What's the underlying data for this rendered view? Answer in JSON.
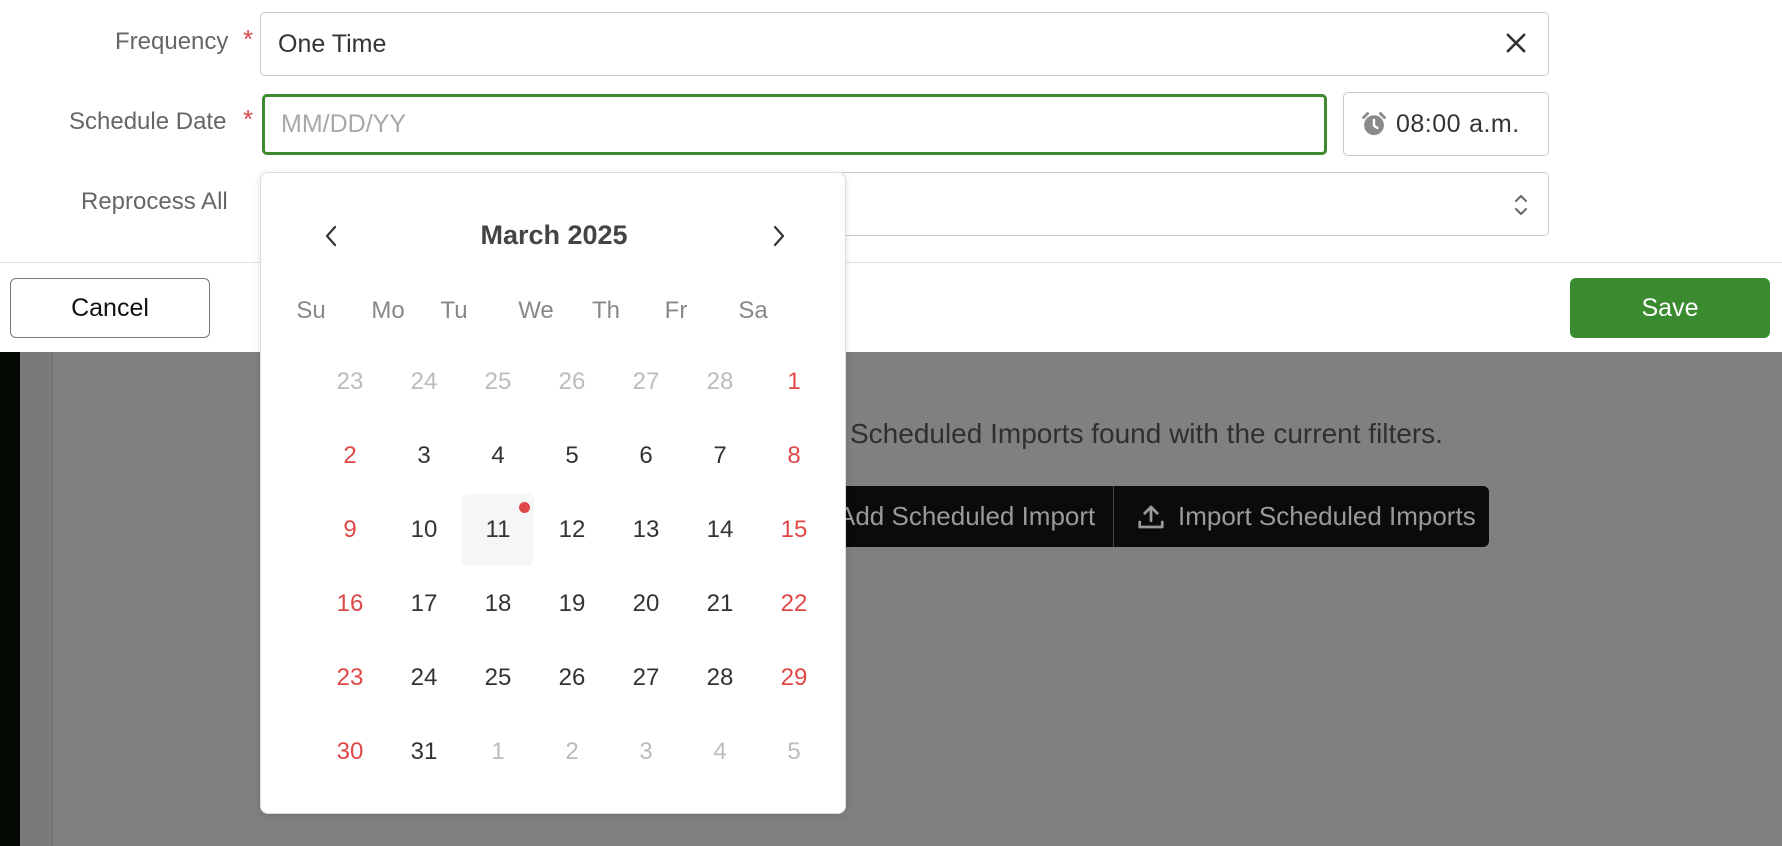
{
  "form": {
    "frequency_label": "Frequency",
    "frequency_value": "One Time",
    "schedule_date_label": "Schedule Date",
    "schedule_date_placeholder": "MM/DD/YY",
    "time_value": "08:00",
    "time_period": "a.m.",
    "reprocess_label": "Reprocess All",
    "required_mark": "*"
  },
  "footer": {
    "cancel_label": "Cancel",
    "save_label": "Save"
  },
  "calendar": {
    "title": "March 2025",
    "weekdays": [
      "Su",
      "Mo",
      "Tu",
      "We",
      "Th",
      "Fr",
      "Sa"
    ],
    "weeks": [
      [
        {
          "d": "23",
          "m": true
        },
        {
          "d": "24",
          "m": true
        },
        {
          "d": "25",
          "m": true
        },
        {
          "d": "26",
          "m": true
        },
        {
          "d": "27",
          "m": true
        },
        {
          "d": "28",
          "m": true
        },
        {
          "d": "1",
          "w": true
        }
      ],
      [
        {
          "d": "2",
          "w": true
        },
        {
          "d": "3"
        },
        {
          "d": "4"
        },
        {
          "d": "5"
        },
        {
          "d": "6"
        },
        {
          "d": "7"
        },
        {
          "d": "8",
          "w": true
        }
      ],
      [
        {
          "d": "9",
          "w": true
        },
        {
          "d": "10"
        },
        {
          "d": "11",
          "today": true
        },
        {
          "d": "12"
        },
        {
          "d": "13"
        },
        {
          "d": "14"
        },
        {
          "d": "15",
          "w": true
        }
      ],
      [
        {
          "d": "16",
          "w": true
        },
        {
          "d": "17"
        },
        {
          "d": "18"
        },
        {
          "d": "19"
        },
        {
          "d": "20"
        },
        {
          "d": "21"
        },
        {
          "d": "22",
          "w": true
        }
      ],
      [
        {
          "d": "23",
          "w": true
        },
        {
          "d": "24"
        },
        {
          "d": "25"
        },
        {
          "d": "26"
        },
        {
          "d": "27"
        },
        {
          "d": "28"
        },
        {
          "d": "29",
          "w": true
        }
      ],
      [
        {
          "d": "30",
          "w": true
        },
        {
          "d": "31"
        },
        {
          "d": "1",
          "m": true
        },
        {
          "d": "2",
          "m": true
        },
        {
          "d": "3",
          "m": true
        },
        {
          "d": "4",
          "m": true
        },
        {
          "d": "5",
          "m": true
        }
      ]
    ]
  },
  "background": {
    "empty_message": "Scheduled Imports found with the current filters.",
    "add_button_label": "Add Scheduled Import",
    "import_button_label": "Import Scheduled Imports"
  },
  "colors": {
    "accent": "#3a8a30",
    "required": "#e04848",
    "backdrop": "#808080"
  },
  "icons": [
    "close-icon",
    "alarm-clock-icon",
    "updown-chevron-icon",
    "chevron-left-icon",
    "chevron-right-icon",
    "upload-icon"
  ]
}
